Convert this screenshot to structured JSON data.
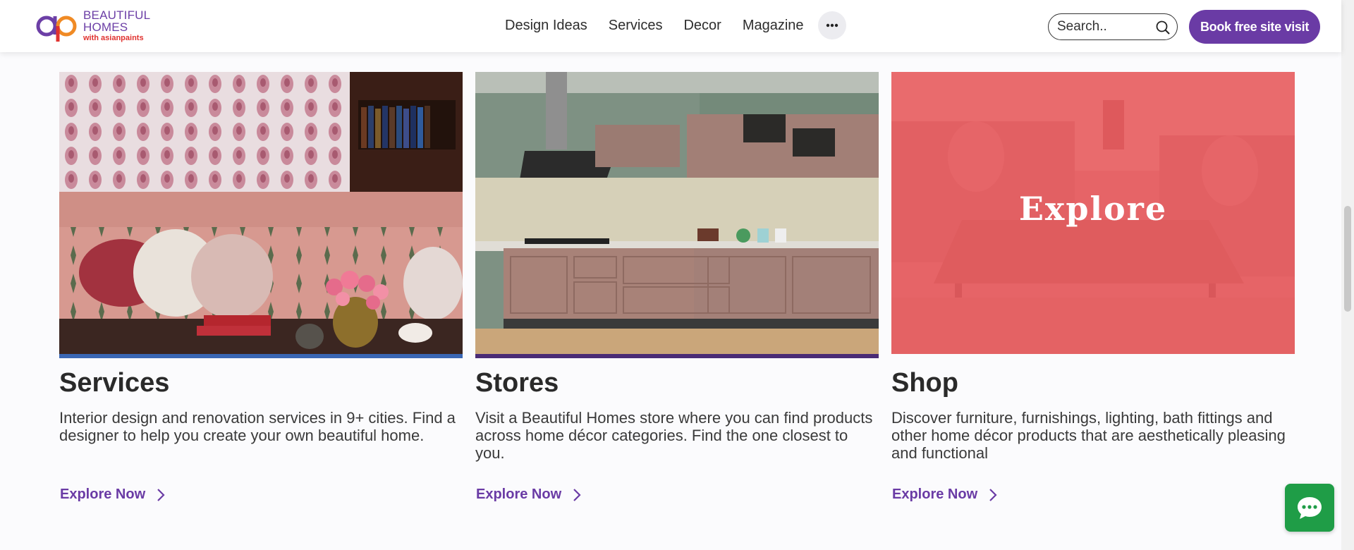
{
  "brand": {
    "line1": "BEAUTIFUL",
    "line2": "HOMES",
    "sub": "with asianpaints"
  },
  "nav": {
    "items": [
      {
        "label": "Design Ideas"
      },
      {
        "label": "Services"
      },
      {
        "label": "Decor"
      },
      {
        "label": "Magazine"
      }
    ],
    "more_label": "···"
  },
  "search": {
    "placeholder": "Search.."
  },
  "cta": {
    "book_label": "Book free site visit"
  },
  "cards": [
    {
      "title": "Services",
      "description": "Interior design and renovation services in 9+ cities. Find a designer to help you create your own beautiful home.",
      "link": "Explore Now",
      "accent": "#3a67b4"
    },
    {
      "title": "Stores",
      "description": "Visit a Beautiful Homes store where you can find products across home décor categories. Find the one closest to you.",
      "link": "Explore Now",
      "accent": "#4a2b75"
    },
    {
      "title": "Shop",
      "description": "Discover furniture, furnishings, lighting, bath fittings and other home décor products that are aesthetically pleasing and functional",
      "link": "Explore Now",
      "overlay_label": "Explore"
    }
  ],
  "colors": {
    "brand_purple": "#6a3ba5",
    "brand_red": "#e0322f",
    "chat_green": "#1f9d47"
  },
  "icons": {
    "search": "search-icon",
    "chevron": "chevron-right-icon",
    "chat": "chat-icon",
    "more": "more-icon"
  }
}
